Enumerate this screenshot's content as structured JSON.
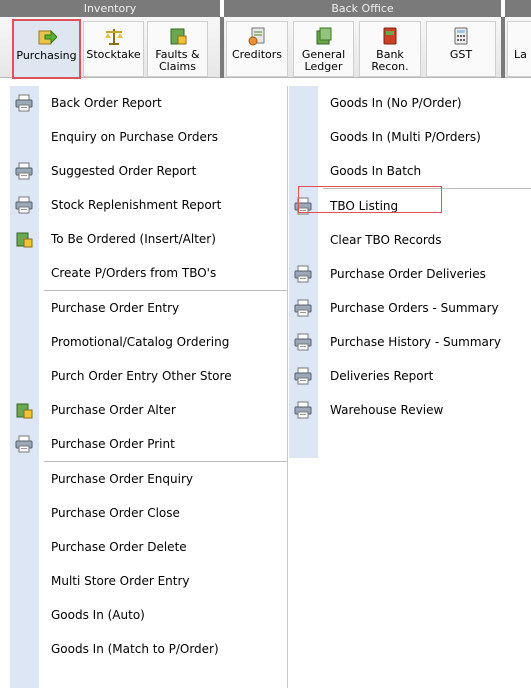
{
  "ribbon": {
    "groups": {
      "inventory": "Inventory",
      "back_office": "Back Office"
    },
    "buttons": [
      {
        "line1": "Purchasing",
        "line2": "",
        "icon": "purchasing-arrow-icon"
      },
      {
        "line1": "Stocktake",
        "line2": "",
        "icon": "scales-icon"
      },
      {
        "line1": "Faults &",
        "line2": "Claims",
        "icon": "faults-icon"
      },
      {
        "line1": "Creditors",
        "line2": "",
        "icon": "creditors-icon"
      },
      {
        "line1": "General",
        "line2": "Ledger",
        "icon": "ledger-icon"
      },
      {
        "line1": "Bank",
        "line2": "Recon.",
        "icon": "bank-book-icon"
      },
      {
        "line1": "GST",
        "line2": "",
        "icon": "calculator-icon"
      },
      {
        "line1": "La",
        "line2": "",
        "icon": ""
      }
    ]
  },
  "left_menu": {
    "items": [
      {
        "label": "Back Order Report",
        "icon": "printer"
      },
      {
        "label": "Enquiry on Purchase Orders",
        "icon": ""
      },
      {
        "label": "Suggested Order Report",
        "icon": "printer"
      },
      {
        "label": "Stock Replenishment Report",
        "icon": "printer"
      },
      {
        "label": "To Be Ordered (Insert/Alter)",
        "icon": "box-edit"
      },
      {
        "label": "Create P/Orders from TBO's",
        "icon": ""
      },
      {
        "label": "Purchase Order Entry",
        "icon": ""
      },
      {
        "label": "Promotional/Catalog Ordering",
        "icon": ""
      },
      {
        "label": "Purch Order Entry Other Store",
        "icon": ""
      },
      {
        "label": "Purchase Order Alter",
        "icon": "box-edit"
      },
      {
        "label": "Purchase Order Print",
        "icon": "printer"
      },
      {
        "label": "Purchase Order Enquiry",
        "icon": ""
      },
      {
        "label": "Purchase Order Close",
        "icon": ""
      },
      {
        "label": "Purchase Order Delete",
        "icon": ""
      },
      {
        "label": "Multi Store Order Entry",
        "icon": ""
      },
      {
        "label": "Goods In (Auto)",
        "icon": ""
      },
      {
        "label": "Goods In (Match to P/Order)",
        "icon": ""
      }
    ]
  },
  "right_menu": {
    "items": [
      {
        "label": "Goods In (No P/Order)",
        "icon": ""
      },
      {
        "label": "Goods In (Multi P/Orders)",
        "icon": ""
      },
      {
        "label": "Goods In Batch",
        "icon": ""
      },
      {
        "label": "TBO Listing",
        "icon": "printer"
      },
      {
        "label": "Clear TBO Records",
        "icon": ""
      },
      {
        "label": "Purchase Order Deliveries",
        "icon": "printer"
      },
      {
        "label": "Purchase Orders - Summary",
        "icon": "printer"
      },
      {
        "label": "Purchase History - Summary",
        "icon": "printer"
      },
      {
        "label": "Deliveries Report",
        "icon": "printer"
      },
      {
        "label": "Warehouse Review",
        "icon": "printer"
      }
    ]
  },
  "colors": {
    "highlight": "#e0525b",
    "gutter": "#dde6f4",
    "group_header": "#7a7a7a"
  }
}
